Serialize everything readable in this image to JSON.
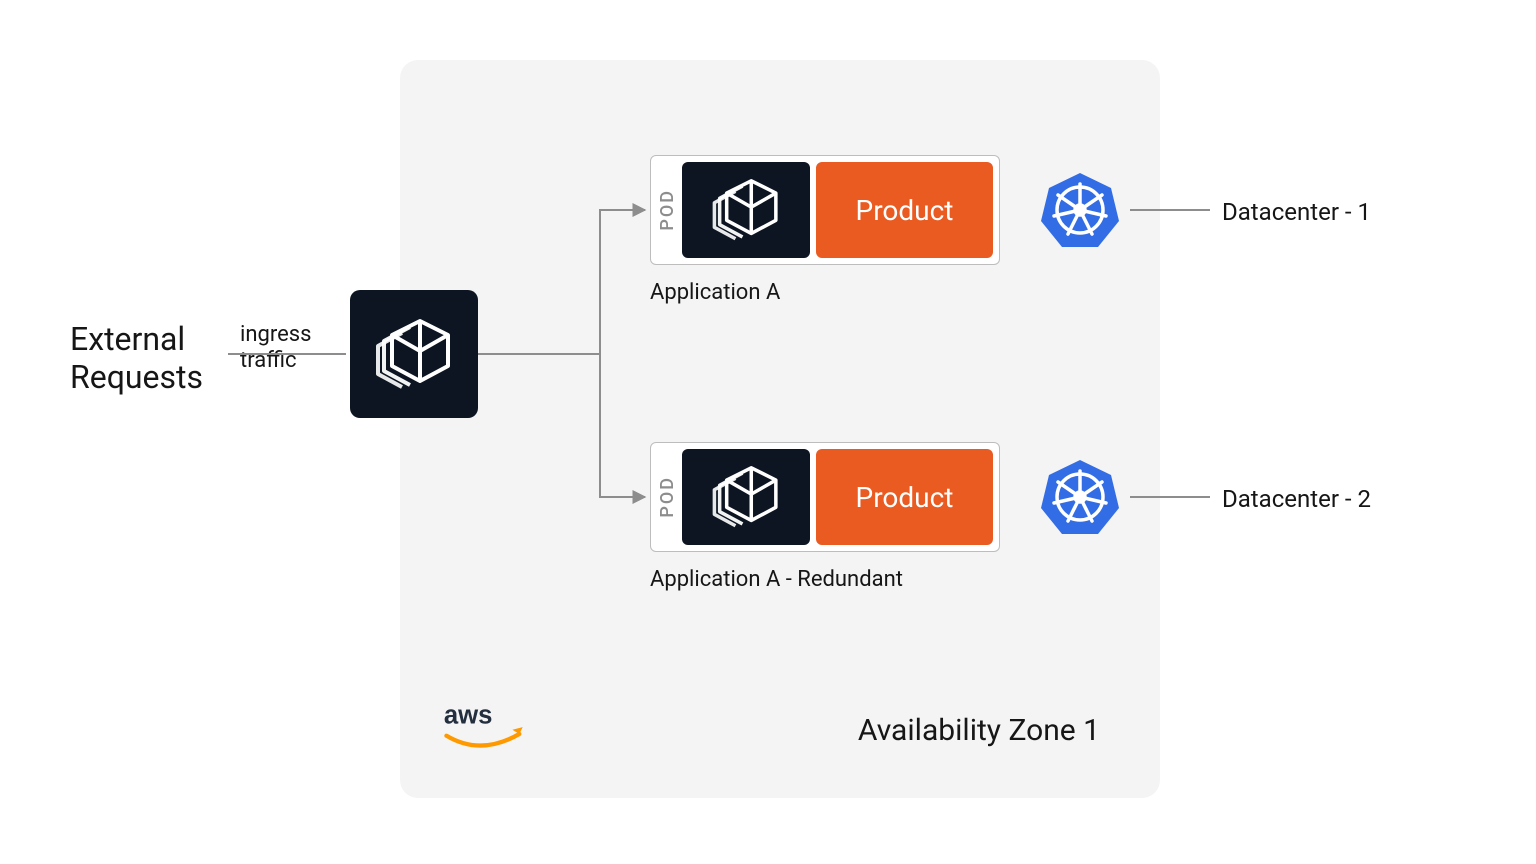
{
  "external_requests": "External\nRequests",
  "ingress": "ingress\ntraffic",
  "zone_title": "Availability Zone 1",
  "aws_label": "aws",
  "pods": {
    "pod_tag": "POD",
    "product_label": "Product",
    "app1_label": "Application A",
    "app2_label": "Application A - Redundant"
  },
  "datacenters": {
    "dc1": "Datacenter - 1",
    "dc2": "Datacenter - 2"
  },
  "colors": {
    "zone_bg": "#f4f4f4",
    "dark_box": "#0c1521",
    "orange": "#ea5b21",
    "k8s_blue": "#326de6",
    "aws_orange": "#ff9900",
    "line": "#8d8d8d"
  }
}
